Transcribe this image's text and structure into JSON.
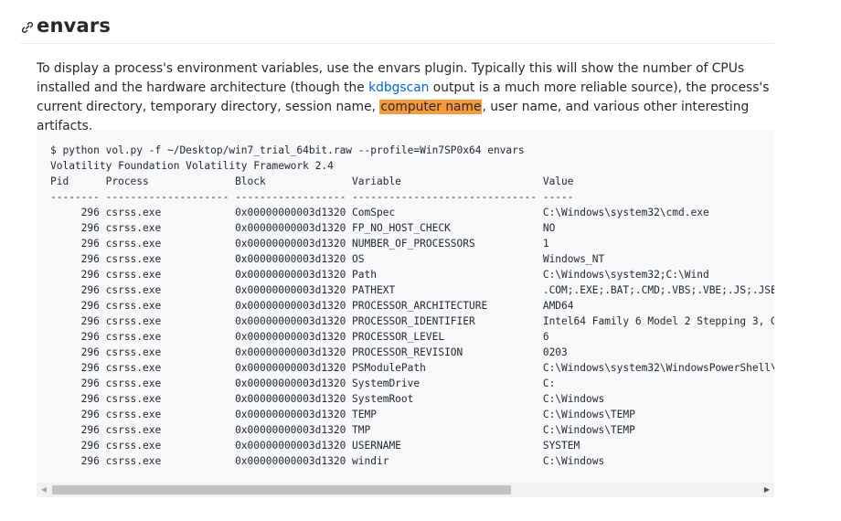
{
  "heading": {
    "icon": "link-icon",
    "title": "envars"
  },
  "paragraph": {
    "part1": "To display a process's environment variables, use the envars plugin. Typically this will show the number of CPUs installed and the hardware architecture (though the ",
    "link": "kdbgscan",
    "part2": " output is a much more reliable source), the process's current directory, temporary directory, session name, ",
    "highlight": "computer name",
    "part3": ", user name, and various other interesting artifacts.",
    "link_color": "#0366d6",
    "highlight_color": "#f79a38"
  },
  "code": {
    "command": "$ python vol.py -f ~/Desktop/win7_trial_64bit.raw --profile=Win7SP0x64 envars",
    "banner": "Volatility Foundation Volatility Framework 2.4",
    "headers": [
      "Pid",
      "Process",
      "Block",
      "Variable",
      "Value"
    ],
    "separator": "-------- -------------------- ------------------ ------------------------------ -----",
    "rows": [
      {
        "pid": "296",
        "process": "csrss.exe",
        "block": "0x00000000003d1320",
        "variable": "ComSpec",
        "value": "C:\\Windows\\system32\\cmd.exe"
      },
      {
        "pid": "296",
        "process": "csrss.exe",
        "block": "0x00000000003d1320",
        "variable": "FP_NO_HOST_CHECK",
        "value": "NO"
      },
      {
        "pid": "296",
        "process": "csrss.exe",
        "block": "0x00000000003d1320",
        "variable": "NUMBER_OF_PROCESSORS",
        "value": "1"
      },
      {
        "pid": "296",
        "process": "csrss.exe",
        "block": "0x00000000003d1320",
        "variable": "OS",
        "value": "Windows_NT"
      },
      {
        "pid": "296",
        "process": "csrss.exe",
        "block": "0x00000000003d1320",
        "variable": "Path",
        "value": "C:\\Windows\\system32;C:\\Wind"
      },
      {
        "pid": "296",
        "process": "csrss.exe",
        "block": "0x00000000003d1320",
        "variable": "PATHEXT",
        "value": ".COM;.EXE;.BAT;.CMD;.VBS;.VBE;.JS;.JSE"
      },
      {
        "pid": "296",
        "process": "csrss.exe",
        "block": "0x00000000003d1320",
        "variable": "PROCESSOR_ARCHITECTURE",
        "value": "AMD64"
      },
      {
        "pid": "296",
        "process": "csrss.exe",
        "block": "0x00000000003d1320",
        "variable": "PROCESSOR_IDENTIFIER",
        "value": "Intel64 Family 6 Model 2 Stepping 3, G"
      },
      {
        "pid": "296",
        "process": "csrss.exe",
        "block": "0x00000000003d1320",
        "variable": "PROCESSOR_LEVEL",
        "value": "6"
      },
      {
        "pid": "296",
        "process": "csrss.exe",
        "block": "0x00000000003d1320",
        "variable": "PROCESSOR_REVISION",
        "value": "0203"
      },
      {
        "pid": "296",
        "process": "csrss.exe",
        "block": "0x00000000003d1320",
        "variable": "PSModulePath",
        "value": "C:\\Windows\\system32\\WindowsPowerShell\\"
      },
      {
        "pid": "296",
        "process": "csrss.exe",
        "block": "0x00000000003d1320",
        "variable": "SystemDrive",
        "value": "C:"
      },
      {
        "pid": "296",
        "process": "csrss.exe",
        "block": "0x00000000003d1320",
        "variable": "SystemRoot",
        "value": "C:\\Windows"
      },
      {
        "pid": "296",
        "process": "csrss.exe",
        "block": "0x00000000003d1320",
        "variable": "TEMP",
        "value": "C:\\Windows\\TEMP"
      },
      {
        "pid": "296",
        "process": "csrss.exe",
        "block": "0x00000000003d1320",
        "variable": "TMP",
        "value": "C:\\Windows\\TEMP"
      },
      {
        "pid": "296",
        "process": "csrss.exe",
        "block": "0x00000000003d1320",
        "variable": "USERNAME",
        "value": "SYSTEM"
      },
      {
        "pid": "296",
        "process": "csrss.exe",
        "block": "0x00000000003d1320",
        "variable": "windir",
        "value": "C:\\Windows"
      }
    ]
  },
  "scrollbar": {
    "left_arrow": "◀",
    "right_arrow": "▶",
    "position": 0,
    "visible_fraction": 0.65
  }
}
